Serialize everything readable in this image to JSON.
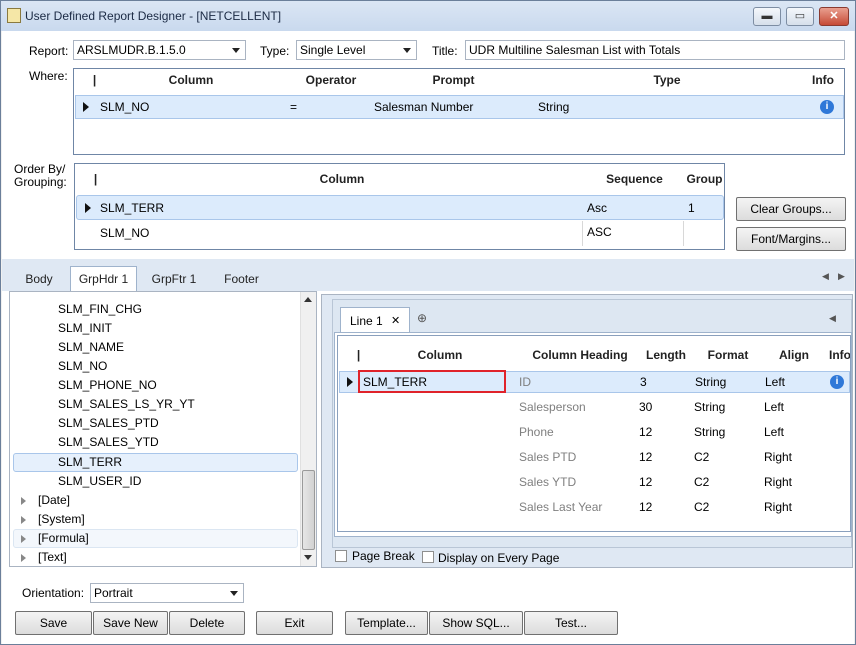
{
  "window": {
    "title": "User Defined Report Designer - [NETCELLENT]",
    "min": "▬",
    "max": "▭",
    "close": "✕"
  },
  "top": {
    "report_label": "Report:",
    "report_value": "ARSLMUDR.B.1.5.0",
    "type_label": "Type:",
    "type_value": "Single Level",
    "title_label": "Title:",
    "title_value": "UDR Multiline Salesman List with Totals",
    "where_label": "Where:",
    "orderby_label": "Order By/\nGrouping:"
  },
  "where_grid": {
    "headers": [
      "Column",
      "Operator",
      "Prompt",
      "Type",
      "Info"
    ],
    "rows": [
      {
        "column": "SLM_NO",
        "operator": "=",
        "prompt": "Salesman Number",
        "type": "String",
        "info": "i"
      }
    ]
  },
  "order_grid": {
    "headers": [
      "Column",
      "Sequence",
      "Group"
    ],
    "rows": [
      {
        "column": "SLM_TERR",
        "sequence": "Asc",
        "group": "1"
      },
      {
        "column": "SLM_NO",
        "sequence": "ASC",
        "group": ""
      }
    ]
  },
  "buttons_right": {
    "clear_groups": "Clear Groups...",
    "font_margins": "Font/Margins..."
  },
  "section_tabs": [
    "Body",
    "GrpHdr 1",
    "GrpFtr 1",
    "Footer"
  ],
  "active_tab": "GrpHdr 1",
  "tree": {
    "items": [
      "SLM_FIN_CHG",
      "SLM_INIT",
      "SLM_NAME",
      "SLM_NO",
      "SLM_PHONE_NO",
      "SLM_SALES_LS_YR_YT",
      "SLM_SALES_PTD",
      "SLM_SALES_YTD",
      "SLM_TERR",
      "SLM_USER_ID"
    ],
    "groups": [
      "[Date]",
      "[System]",
      "[Formula]",
      "[Text]"
    ]
  },
  "line_tab": {
    "label": "Line 1",
    "close": "✕",
    "add": "⊕"
  },
  "line_grid": {
    "headers": [
      "Column",
      "Column Heading",
      "Length",
      "Format",
      "Align",
      "Info"
    ],
    "rows": [
      {
        "column": "SLM_TERR",
        "heading": "ID",
        "length": "3",
        "format": "String",
        "align": "Left",
        "info": "i"
      },
      {
        "column": "",
        "heading": "Salesperson",
        "length": "30",
        "format": "String",
        "align": "Left"
      },
      {
        "column": "",
        "heading": "Phone",
        "length": "12",
        "format": "String",
        "align": "Left"
      },
      {
        "column": "",
        "heading": "Sales PTD",
        "length": "12",
        "format": "C2",
        "align": "Right"
      },
      {
        "column": "",
        "heading": "Sales YTD",
        "length": "12",
        "format": "C2",
        "align": "Right"
      },
      {
        "column": "",
        "heading": "Sales Last Year",
        "length": "12",
        "format": "C2",
        "align": "Right"
      }
    ]
  },
  "options": {
    "page_break": "Page Break",
    "every_page": "Display on Every Page"
  },
  "orientation": {
    "label": "Orientation:",
    "value": "Portrait"
  },
  "bottom_buttons": {
    "save": "Save",
    "save_new": "Save New",
    "delete": "Delete",
    "exit": "Exit",
    "template": "Template...",
    "show_sql": "Show SQL...",
    "test": "Test..."
  }
}
